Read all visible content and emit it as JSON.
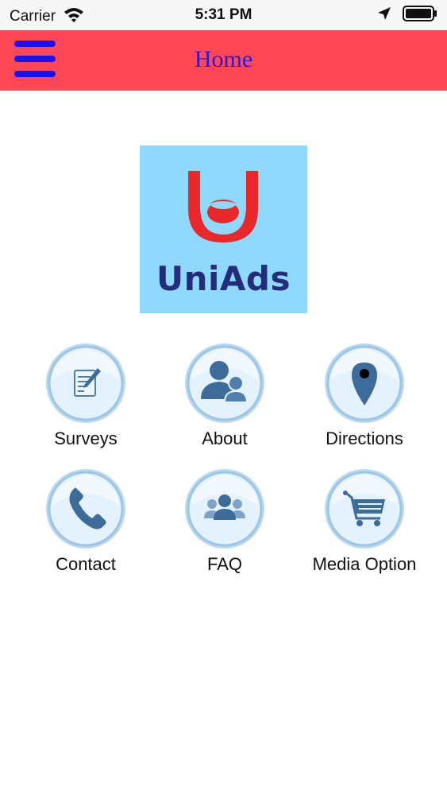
{
  "status_bar": {
    "carrier": "Carrier",
    "time": "5:31 PM"
  },
  "nav": {
    "title": "Home"
  },
  "logo": {
    "text": "UniAds"
  },
  "tiles": [
    {
      "label": "Surveys",
      "icon": "survey-icon"
    },
    {
      "label": "About",
      "icon": "people-icon"
    },
    {
      "label": "Directions",
      "icon": "map-pin-icon"
    },
    {
      "label": "Contact",
      "icon": "phone-icon"
    },
    {
      "label": "FAQ",
      "icon": "group-icon"
    },
    {
      "label": "Media Option",
      "icon": "cart-icon"
    }
  ],
  "colors": {
    "nav_bar": "#ff4757",
    "menu_icon": "#1a11ee",
    "title": "#3317c9",
    "logo_bg": "#8fd9ff",
    "logo_text": "#232d7a",
    "logo_mark": "#e8282b",
    "icon_fill": "#3d6b9a"
  }
}
